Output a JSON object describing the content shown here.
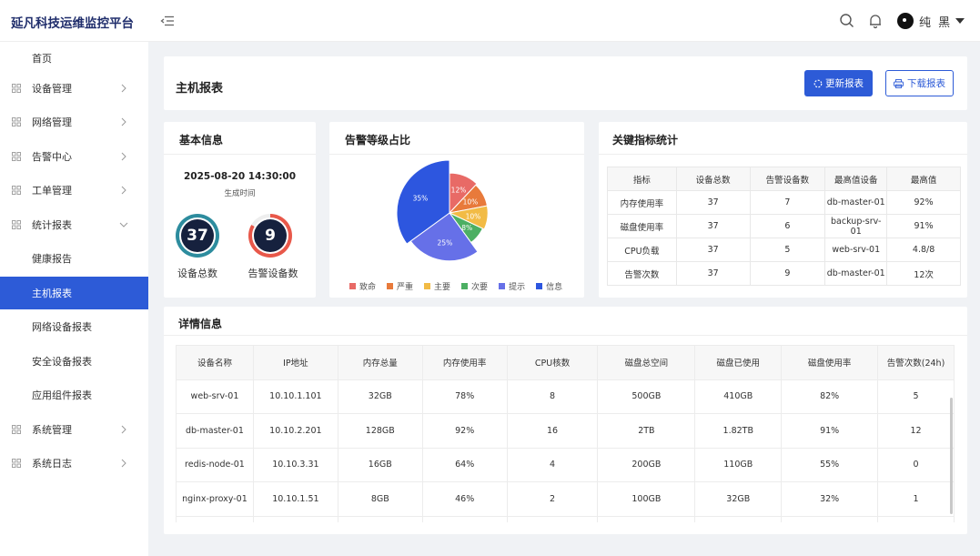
{
  "header": {
    "brand": "延凡科技运维监控平台",
    "username": "纯 黑"
  },
  "sidebar": {
    "items": [
      {
        "label": "首页"
      },
      {
        "label": "设备管理"
      },
      {
        "label": "网络管理"
      },
      {
        "label": "告警中心"
      },
      {
        "label": "工单管理"
      },
      {
        "label": "统计报表"
      },
      {
        "label": "健康报告"
      },
      {
        "label": "主机报表"
      },
      {
        "label": "网络设备报表"
      },
      {
        "label": "安全设备报表"
      },
      {
        "label": "应用组件报表"
      },
      {
        "label": "系统管理"
      },
      {
        "label": "系统日志"
      }
    ]
  },
  "page": {
    "title": "主机报表",
    "refresh_label": "更新报表",
    "download_label": "下载报表"
  },
  "basic_info": {
    "title": "基本信息",
    "timestamp": "2025-08-20 14:30:00",
    "timestamp_caption": "生成时间",
    "total_devices": "37",
    "total_devices_label": "设备总数",
    "alert_devices": "9",
    "alert_devices_label": "告警设备数"
  },
  "alert_levels": {
    "title": "告警等级占比"
  },
  "chart_data": {
    "type": "pie",
    "categories": [
      "致命",
      "严重",
      "主要",
      "次要",
      "提示",
      "信息"
    ],
    "values": [
      12,
      10,
      10,
      8,
      25,
      35
    ],
    "labels": [
      "12%",
      "10%",
      "10%",
      "8%",
      "25%",
      "35%"
    ],
    "colors": [
      "#e86a66",
      "#e87a3b",
      "#f2bb45",
      "#4caf63",
      "#6670e8",
      "#2d56df"
    ],
    "legend_position": "bottom"
  },
  "kpi": {
    "title": "关键指标统计",
    "headers": [
      "指标",
      "设备总数",
      "告警设备数",
      "最高值设备",
      "最高值"
    ],
    "rows": [
      [
        "内存使用率",
        "37",
        "7",
        "db-master-01",
        "92%"
      ],
      [
        "磁盘使用率",
        "37",
        "6",
        "backup-srv-01",
        "91%"
      ],
      [
        "CPU负载",
        "37",
        "5",
        "web-srv-01",
        "4.8/8"
      ],
      [
        "告警次数",
        "37",
        "9",
        "db-master-01",
        "12次"
      ]
    ]
  },
  "details": {
    "title": "详情信息",
    "headers": [
      "设备名称",
      "IP地址",
      "内存总量",
      "内存使用率",
      "CPU核数",
      "磁盘总空间",
      "磁盘已使用",
      "磁盘使用率",
      "告警次数(24h)"
    ],
    "rows": [
      [
        "web-srv-01",
        "10.10.1.101",
        "32GB",
        "78%",
        "8",
        "500GB",
        "410GB",
        "82%",
        "5"
      ],
      [
        "db-master-01",
        "10.10.2.201",
        "128GB",
        "92%",
        "16",
        "2TB",
        "1.82TB",
        "91%",
        "12"
      ],
      [
        "redis-node-01",
        "10.10.3.31",
        "16GB",
        "64%",
        "4",
        "200GB",
        "110GB",
        "55%",
        "0"
      ],
      [
        "nginx-proxy-01",
        "10.10.1.51",
        "8GB",
        "46%",
        "2",
        "100GB",
        "32GB",
        "32%",
        "1"
      ]
    ]
  }
}
